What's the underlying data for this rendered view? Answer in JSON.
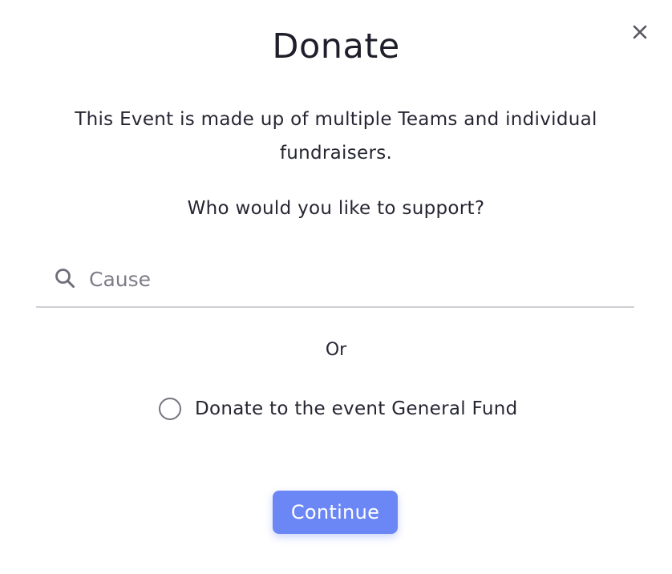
{
  "modal": {
    "title": "Donate",
    "close_icon": "close-icon",
    "intro_text": "This Event is made up of multiple Teams and individual fundraisers.",
    "question_text": "Who would you like to support?",
    "search": {
      "icon": "search-icon",
      "placeholder": "Cause",
      "value": ""
    },
    "or_text": "Or",
    "general_fund_option": {
      "label": "Donate to the event General Fund",
      "checked": false
    },
    "continue_label": "Continue"
  },
  "colors": {
    "accent": "#6b86f5",
    "text": "#262633",
    "placeholder": "#7d7d88",
    "divider": "#cfcfd4"
  }
}
